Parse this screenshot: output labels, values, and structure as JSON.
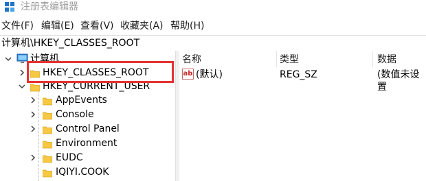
{
  "window": {
    "title": "注册表编辑器"
  },
  "menu": [
    "文件(F)",
    "编辑(E)",
    "查看(V)",
    "收藏夹(A)",
    "帮助(H)"
  ],
  "address": "计算机\\HKEY_CLASSES_ROOT",
  "tree": {
    "computer": "计算机",
    "hkcr": "HKEY_CLASSES_ROOT",
    "hkcu": "HKEY_CURRENT_USER",
    "children": [
      "AppEvents",
      "Console",
      "Control Panel",
      "Environment",
      "EUDC",
      "IQIYI.COOK"
    ]
  },
  "list": {
    "headers": {
      "name": "名称",
      "type": "类型",
      "data": "数据"
    },
    "rows": [
      {
        "icon": "string-value-icon",
        "icon_text": "ab",
        "name": "(默认)",
        "type": "REG_SZ",
        "data": "(数值未设置"
      }
    ]
  },
  "colors": {
    "highlight_border": "#e63232",
    "folder": "#f6c844",
    "title_text": "#9b9b9b"
  }
}
